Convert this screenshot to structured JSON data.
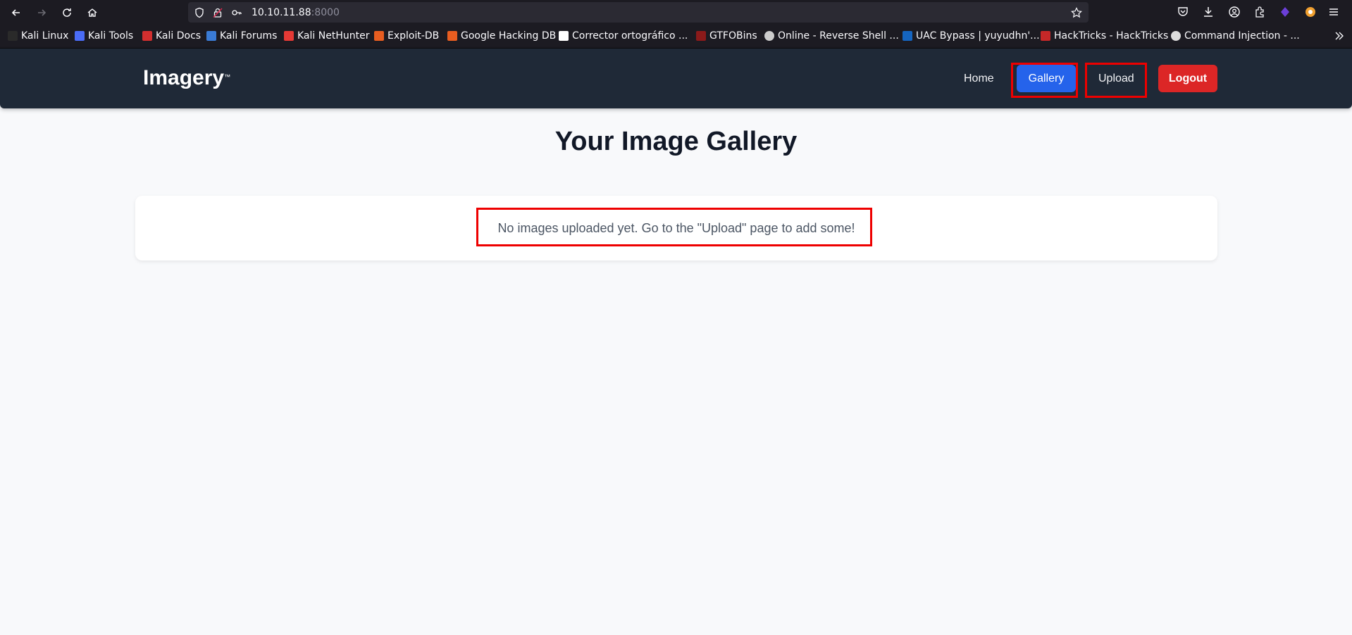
{
  "browser": {
    "url_host": "10.10.11.88",
    "url_port": ":8000",
    "bookmarks": [
      {
        "label": "Kali Linux",
        "color": "#2a2a2a"
      },
      {
        "label": "Kali Tools",
        "color": "#4a6cf7"
      },
      {
        "label": "Kali Docs",
        "color": "#d32f2f"
      },
      {
        "label": "Kali Forums",
        "color": "#3a7bd5"
      },
      {
        "label": "Kali NetHunter",
        "color": "#e53935"
      },
      {
        "label": "Exploit-DB",
        "color": "#e85d20"
      },
      {
        "label": "Google Hacking DB",
        "color": "#e85d20"
      },
      {
        "label": "Corrector ortográfico ...",
        "color": "#ffffff"
      },
      {
        "label": "GTFOBins",
        "color": "#8b1a1a"
      },
      {
        "label": "Online - Reverse Shell ...",
        "color": "#cccccc"
      },
      {
        "label": "UAC Bypass | yuyudhn'...",
        "color": "#1565c0"
      },
      {
        "label": "HackTricks - HackTricks",
        "color": "#c62828"
      },
      {
        "label": "Command Injection - ...",
        "color": "#dddddd"
      }
    ]
  },
  "site": {
    "logo": "Imagery",
    "logo_tm": "™",
    "nav": {
      "home": "Home",
      "gallery": "Gallery",
      "upload": "Upload",
      "logout": "Logout"
    }
  },
  "main": {
    "title": "Your Image Gallery",
    "empty_message": "No images uploaded yet. Go to the \"Upload\" page to add some!"
  },
  "colors": {
    "header_bg": "#1f2937",
    "gallery_active": "#2563eb",
    "logout": "#dc2626",
    "highlight": "#ee0000"
  }
}
